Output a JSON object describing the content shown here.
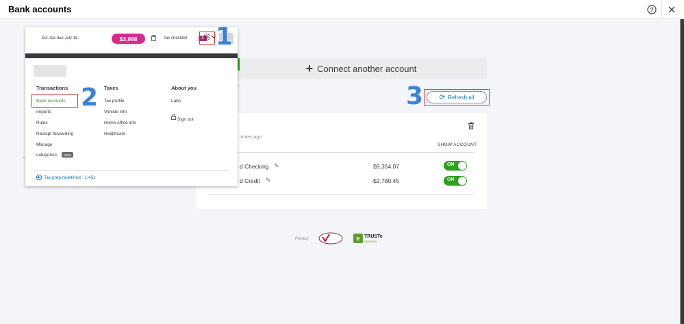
{
  "window": {
    "title": "Bank accounts",
    "help_icon": "help-circle-icon",
    "close_icon": "close-icon"
  },
  "topbar": {
    "est_tax_label": "Est. tax due July 15:",
    "est_tax_amount": "$3,988",
    "tax_checklist_label": "Tax checklist",
    "tax_checklist_count": "1",
    "gear_icon": "gear-icon",
    "accent_pink": "#d52b8e"
  },
  "settings_menu": {
    "columns": [
      {
        "heading": "Transactions",
        "items": [
          "Bank accounts",
          "Imports",
          "Rules",
          "Receipt forwarding",
          "Manage",
          "categories"
        ]
      },
      {
        "heading": "Taxes",
        "items": [
          "Tax profile",
          "Vehicle info",
          "Home office info",
          "Healthcare"
        ]
      },
      {
        "heading": "About you",
        "items": [
          "Labs",
          "Sign out"
        ]
      }
    ],
    "new_badge": "NEW",
    "footer_link": "Tax prep redefined - 1:45s",
    "active_color": "#2ca01c"
  },
  "main": {
    "connect_label": "Connect another account",
    "refresh_label": "Refresh all",
    "updated_text": "inutes ago",
    "show_account_header": "SHOW ACCOUNT",
    "accounts": [
      {
        "name": "d Checking",
        "balance": "$9,354.07",
        "toggle": "ON"
      },
      {
        "name": "d Credit",
        "balance": "-$2,780.45",
        "toggle": "ON"
      }
    ],
    "toggle_color": "#2ca01c"
  },
  "footer": {
    "privacy_label": "Privacy",
    "verisign_text": "VeriSign Secured",
    "truste_name": "TRUSTe",
    "truste_sub": "VERIFIED"
  },
  "annotations": {
    "step1": "1",
    "step2": "2",
    "step3": "3",
    "highlight_color": "#e0333a",
    "number_color": "#3b82d6"
  }
}
